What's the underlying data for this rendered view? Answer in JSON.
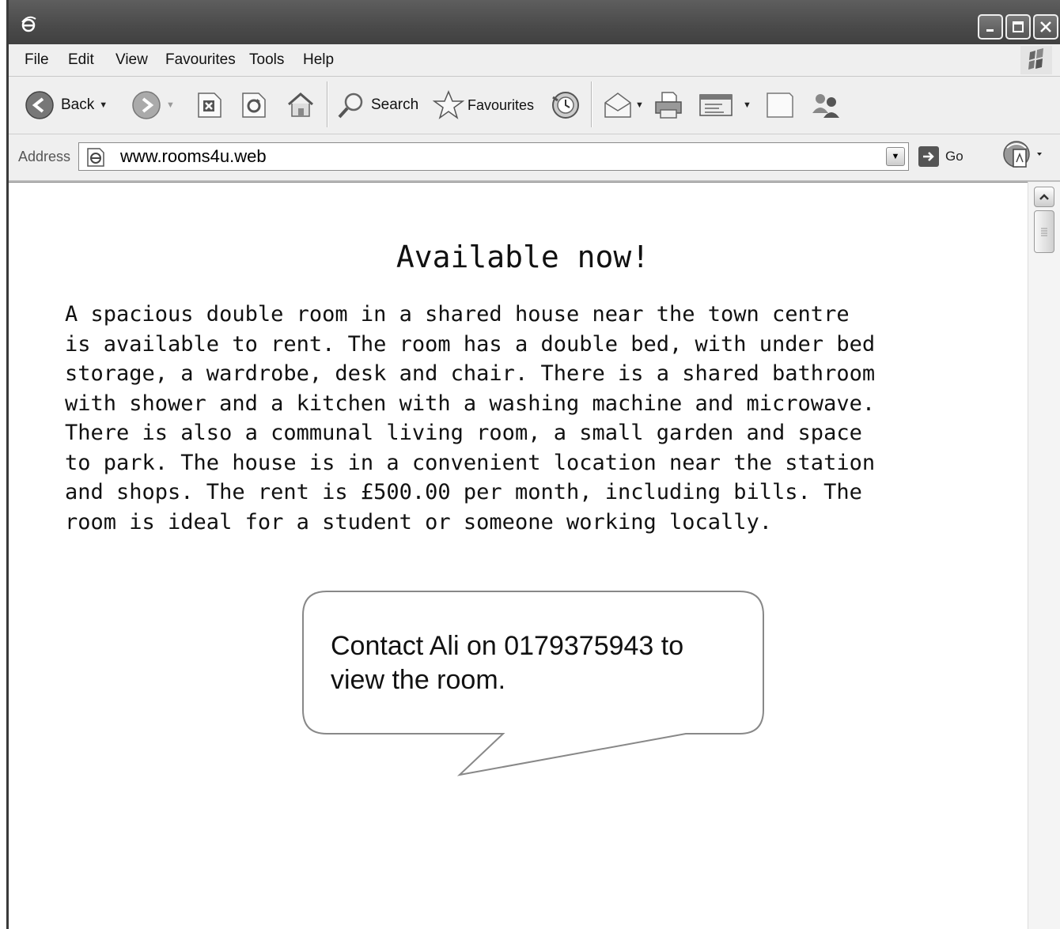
{
  "menu": {
    "file": "File",
    "edit": "Edit",
    "view": "View",
    "favourites": "Favourites",
    "tools": "Tools",
    "help": "Help"
  },
  "toolbar": {
    "back_label": "Back",
    "search_label": "Search",
    "favourites_label": "Favourites"
  },
  "address": {
    "label": "Address",
    "url": "www.rooms4u.web",
    "go_label": "Go"
  },
  "page": {
    "heading": "Available now!",
    "body_lines": [
      "A spacious double room in a shared house near the town centre",
      "is available to rent. The room has a double bed, with under bed",
      "storage, a wardrobe, desk and chair. There is a shared bathroom",
      "with shower and a kitchen with a washing machine and microwave.",
      "There is also a communal living room, a small garden and space",
      "to park. The house is in a convenient location near the station",
      "and shops. The rent is £500.00 per month, including bills. The",
      "room is ideal for a student or someone working locally."
    ],
    "callout": "Contact Ali on 0179375943 to view the room."
  }
}
